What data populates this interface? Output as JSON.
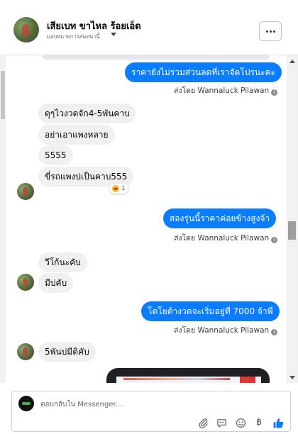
{
  "header": {
    "name": "เสียเบท ขาไหล ร้อยเอ็ด",
    "subtitle": "มอบหมายการสนทนานี้",
    "more_icon": "more-horizontal-icon"
  },
  "messages": [
    {
      "from": "page",
      "text": "ราคายังไม่รวมส่วนลดที่เราจัดโปรนะคะ"
    },
    {
      "from": "page",
      "sent_by": "ส่งโดย Wannaluck Pilawan"
    },
    {
      "from": "customer",
      "text": "ดุๆไวงวดจัก4-5พันคาบ"
    },
    {
      "from": "customer",
      "text": "อย่าเอาแพงหลาย"
    },
    {
      "from": "customer",
      "text": "5555"
    },
    {
      "from": "customer",
      "text": "ขี่รถแพงบ่เป็นคาบ555",
      "reaction_count": "1"
    },
    {
      "from": "page",
      "text": "สองรุ่นนี้ราคาค่อยข้างสูงจ้า"
    },
    {
      "from": "page",
      "sent_by": "ส่งโดย Wannaluck Pilawan"
    },
    {
      "from": "customer",
      "text": "วีโก้นะคับ"
    },
    {
      "from": "customer",
      "text": "มีบ่คับ"
    },
    {
      "from": "page",
      "text": "โดโยต้างวดจะเริ่มอยู่ที่ 7000 จ้าพี่"
    },
    {
      "from": "page",
      "sent_by": "ส่งโดย Wannaluck Pilawan"
    },
    {
      "from": "customer",
      "text": "5พันบ่มีติคับ"
    }
  ],
  "composer": {
    "placeholder": "ตอบกลับใน Messenger...",
    "tools": [
      "paperclip-icon",
      "saved-reply-icon",
      "emoji-icon",
      "baht-icon",
      "thumbs-up-icon"
    ],
    "baht_symbol": "฿"
  },
  "colors": {
    "outgoing_bubble": "#0a7cff",
    "incoming_bubble": "#f0f0f0",
    "like_blue": "#0a7cff"
  }
}
